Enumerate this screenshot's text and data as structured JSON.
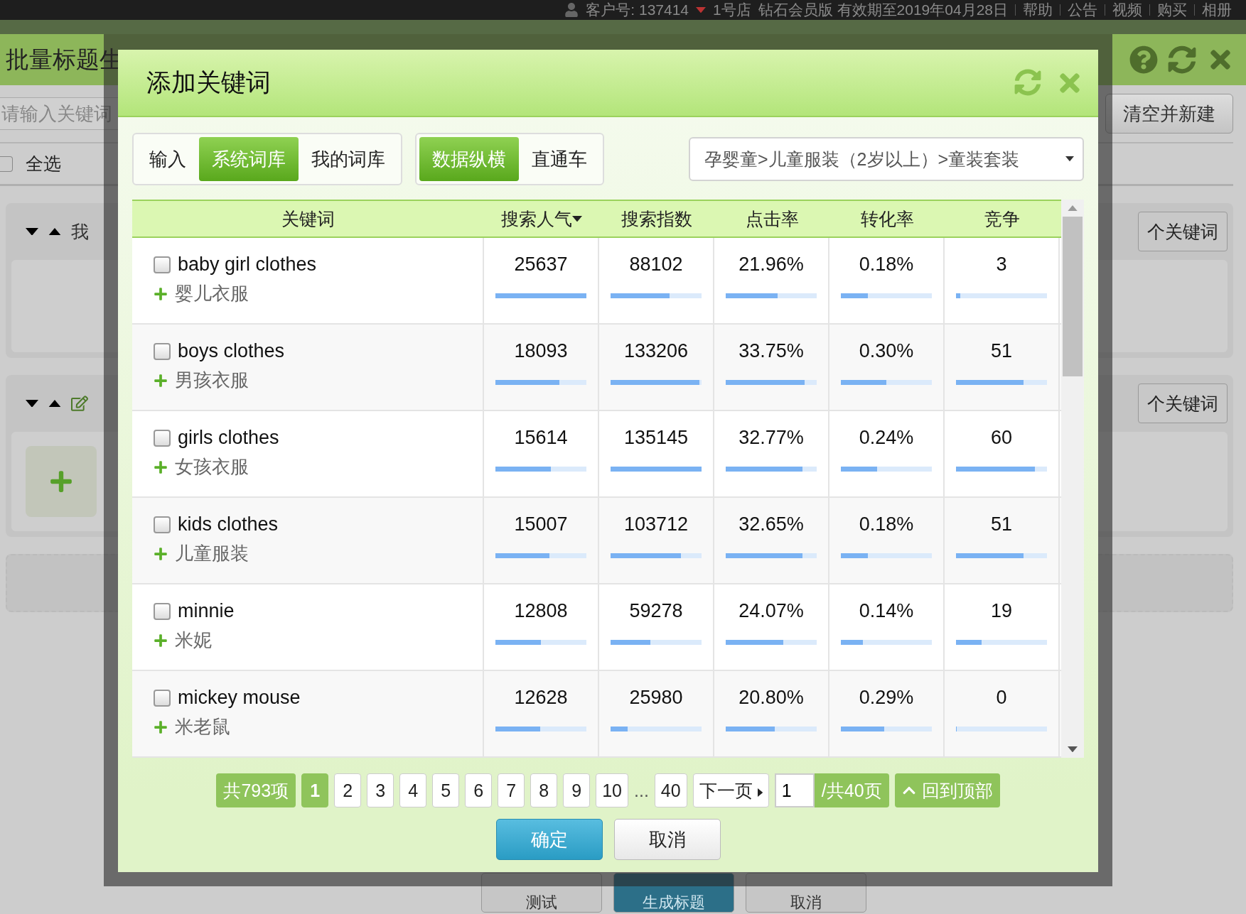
{
  "top_bar": {
    "customer": "客户号: 137414",
    "shop": "1号店",
    "edition": "钻石会员版 有效期至2019年04月28日",
    "links": [
      "帮助",
      "公告",
      "视频",
      "购买",
      "相册"
    ]
  },
  "app": {
    "title": "批量标题生",
    "search": {
      "placeholder": "请输入关键词"
    },
    "clear_button": "清空并新建",
    "select_all": {
      "label": "全选",
      "checked": false
    },
    "groups": [
      {
        "name": "我",
        "count_label": "个关键词",
        "editable": false,
        "add_tile": false
      },
      {
        "count_label": "个关键词",
        "editable": true,
        "add_tile": true
      }
    ],
    "buttons": [
      "测试",
      "生成标题",
      "取消"
    ]
  },
  "dialog": {
    "title": "添加关键词",
    "source_tabs": [
      {
        "label": "输入",
        "selected": false
      },
      {
        "label": "系统词库",
        "selected": true
      },
      {
        "label": "我的词库",
        "selected": false
      }
    ],
    "data_tabs": [
      {
        "label": "数据纵横",
        "selected": true
      },
      {
        "label": "直通车",
        "selected": false
      }
    ],
    "category": "孕婴童>儿童服装（2岁以上）>童装套装",
    "columns": [
      {
        "label": "关键词",
        "sorted": false
      },
      {
        "label": "搜索人气",
        "sorted": true
      },
      {
        "label": "搜索指数",
        "sorted": false
      },
      {
        "label": "点击率",
        "sorted": false
      },
      {
        "label": "转化率",
        "sorted": false
      },
      {
        "label": "竞争",
        "sorted": false
      }
    ],
    "rows": [
      {
        "keyword": "baby girl clothes",
        "translation": "婴儿衣服",
        "checked": false,
        "metrics": [
          {
            "value": "25637",
            "level": 1.0
          },
          {
            "value": "88102",
            "level": 0.65
          },
          {
            "value": "21.96%",
            "level": 0.57
          },
          {
            "value": "0.18%",
            "level": 0.3
          },
          {
            "value": "3",
            "level": 0.05
          }
        ]
      },
      {
        "keyword": "boys clothes",
        "translation": "男孩衣服",
        "checked": false,
        "metrics": [
          {
            "value": "18093",
            "level": 0.7
          },
          {
            "value": "133206",
            "level": 0.98
          },
          {
            "value": "33.75%",
            "level": 0.87
          },
          {
            "value": "0.30%",
            "level": 0.5
          },
          {
            "value": "51",
            "level": 0.74
          }
        ]
      },
      {
        "keyword": "girls clothes",
        "translation": "女孩衣服",
        "checked": false,
        "metrics": [
          {
            "value": "15614",
            "level": 0.61
          },
          {
            "value": "135145",
            "level": 1.0
          },
          {
            "value": "32.77%",
            "level": 0.84
          },
          {
            "value": "0.24%",
            "level": 0.4
          },
          {
            "value": "60",
            "level": 0.87
          }
        ]
      },
      {
        "keyword": "kids clothes",
        "translation": "儿童服装",
        "checked": false,
        "metrics": [
          {
            "value": "15007",
            "level": 0.59
          },
          {
            "value": "103712",
            "level": 0.77
          },
          {
            "value": "32.65%",
            "level": 0.84
          },
          {
            "value": "0.18%",
            "level": 0.3
          },
          {
            "value": "51",
            "level": 0.74
          }
        ]
      },
      {
        "keyword": "minnie",
        "translation": "米妮",
        "checked": false,
        "metrics": [
          {
            "value": "12808",
            "level": 0.5
          },
          {
            "value": "59278",
            "level": 0.44
          },
          {
            "value": "24.07%",
            "level": 0.63
          },
          {
            "value": "0.14%",
            "level": 0.24
          },
          {
            "value": "19",
            "level": 0.28
          }
        ]
      },
      {
        "keyword": "mickey mouse",
        "translation": "米老鼠",
        "checked": false,
        "metrics": [
          {
            "value": "12628",
            "level": 0.49
          },
          {
            "value": "25980",
            "level": 0.19
          },
          {
            "value": "20.80%",
            "level": 0.54
          },
          {
            "value": "0.29%",
            "level": 0.48
          },
          {
            "value": "0",
            "level": 0.0
          }
        ]
      }
    ],
    "pagination": {
      "total": "共793项",
      "pages": [
        {
          "label": "1",
          "selected": true
        },
        {
          "label": "2",
          "selected": false
        },
        {
          "label": "3",
          "selected": false
        },
        {
          "label": "4",
          "selected": false
        },
        {
          "label": "5",
          "selected": false
        },
        {
          "label": "6",
          "selected": false
        },
        {
          "label": "7",
          "selected": false
        },
        {
          "label": "8",
          "selected": false
        },
        {
          "label": "9",
          "selected": false
        },
        {
          "label": "10",
          "selected": false
        }
      ],
      "ellipsis": "...",
      "last_page": "40",
      "next": "下一页",
      "page_input": "1",
      "page_count": "/共40页",
      "back_to_top": "回到顶部"
    },
    "confirm": "确定",
    "cancel": "取消"
  }
}
